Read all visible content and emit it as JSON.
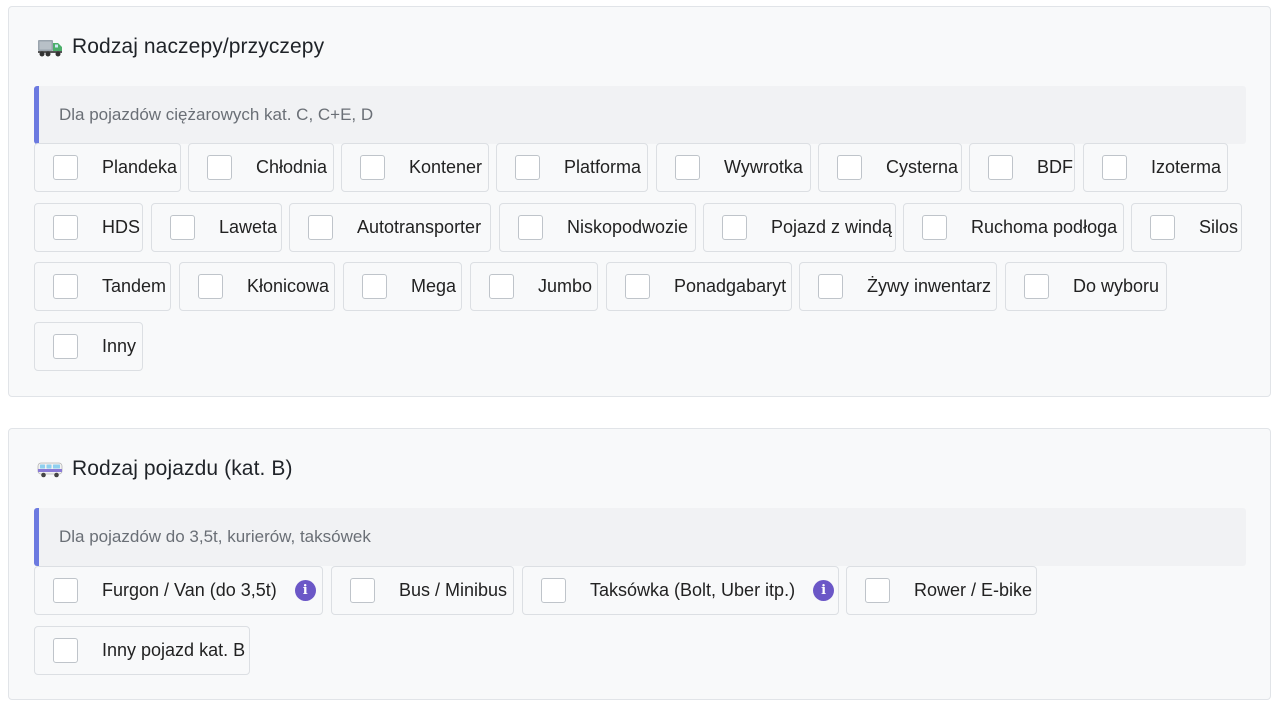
{
  "sections": [
    {
      "icon": "truck-icon",
      "title": "Rodzaj naczepy/przyczepy",
      "hint": "Dla pojazdów ciężarowych kat. C, C+E, D",
      "options": [
        {
          "label": "Plandeka",
          "checked": false
        },
        {
          "label": "Chłodnia",
          "checked": false
        },
        {
          "label": "Kontener",
          "checked": false
        },
        {
          "label": "Platforma",
          "checked": false
        },
        {
          "label": "Wywrotka",
          "checked": false
        },
        {
          "label": "Cysterna",
          "checked": false
        },
        {
          "label": "BDF",
          "checked": false
        },
        {
          "label": "Izoterma",
          "checked": false
        },
        {
          "label": "HDS",
          "checked": false
        },
        {
          "label": "Laweta",
          "checked": false
        },
        {
          "label": "Autotransporter",
          "checked": false
        },
        {
          "label": "Niskopodwozie",
          "checked": false
        },
        {
          "label": "Pojazd z windą",
          "checked": false
        },
        {
          "label": "Ruchoma podłoga",
          "checked": false
        },
        {
          "label": "Silos",
          "checked": false
        },
        {
          "label": "Tandem",
          "checked": false
        },
        {
          "label": "Kłonicowa",
          "checked": false
        },
        {
          "label": "Mega",
          "checked": false
        },
        {
          "label": "Jumbo",
          "checked": false
        },
        {
          "label": "Ponadgabaryt",
          "checked": false
        },
        {
          "label": "Żywy inwentarz",
          "checked": false
        },
        {
          "label": "Do wyboru",
          "checked": false
        },
        {
          "label": "Inny",
          "checked": false
        }
      ]
    },
    {
      "icon": "bus-icon",
      "title": "Rodzaj pojazdu (kat. B)",
      "hint": "Dla pojazdów do 3,5t, kurierów, taksówek",
      "options": [
        {
          "label": "Furgon / Van (do 3,5t)",
          "checked": false,
          "info": true
        },
        {
          "label": "Bus / Minibus",
          "checked": false
        },
        {
          "label": "Taksówka (Bolt, Uber itp.)",
          "checked": false,
          "info": true
        },
        {
          "label": "Rower / E-bike",
          "checked": false
        },
        {
          "label": "Inny pojazd kat. B",
          "checked": false
        }
      ]
    }
  ],
  "info_glyph": "i",
  "colors": {
    "accent": "#6c7ae0",
    "info": "#6b57c7"
  }
}
